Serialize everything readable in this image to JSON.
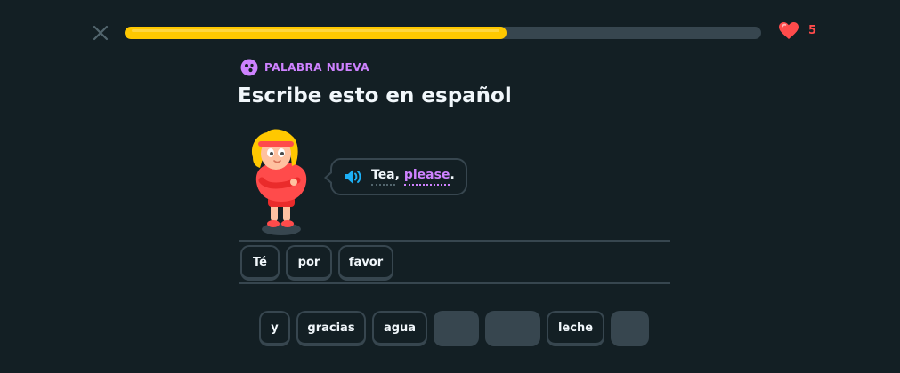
{
  "progress": {
    "fraction": 0.6
  },
  "hearts": {
    "count": "5",
    "icon": "heart-icon",
    "color": "#ff4b4b"
  },
  "header": {
    "badge_label": "PALABRA NUEVA",
    "title": "Escribe esto en español"
  },
  "prompt": {
    "words": [
      {
        "text": "Tea",
        "is_new": false
      },
      {
        "text": ",",
        "is_new": false
      },
      {
        "text": "please",
        "is_new": true
      },
      {
        "text": ".",
        "is_new": false
      }
    ]
  },
  "answer": {
    "tiles": [
      "Té",
      "por",
      "favor"
    ]
  },
  "word_bank": {
    "tiles": [
      {
        "label": "y",
        "used": false
      },
      {
        "label": "gracias",
        "used": false
      },
      {
        "label": "agua",
        "used": false
      },
      {
        "label": "",
        "used": true
      },
      {
        "label": "",
        "used": true
      },
      {
        "label": "leche",
        "used": false
      },
      {
        "label": "",
        "used": true
      }
    ]
  },
  "colors": {
    "background": "#131f24",
    "progress": "#ffc800",
    "accent_purple": "#ce82ff",
    "border": "#37464f",
    "speaker": "#1cb0f6"
  }
}
